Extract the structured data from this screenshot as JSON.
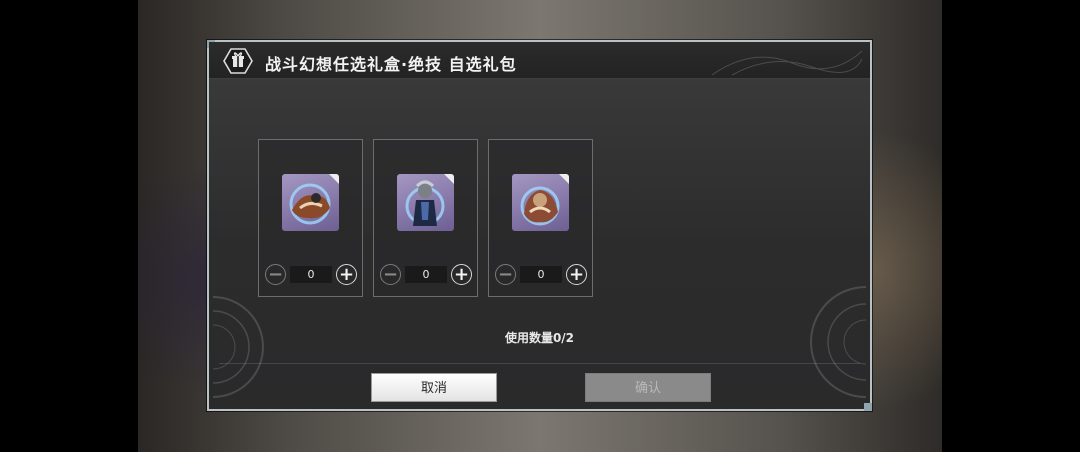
{
  "dialog": {
    "title": "战斗幻想任选礼盒·绝技 自选礼包",
    "header_icon": "gift-box-icon"
  },
  "items": [
    {
      "name": "skill-item-1",
      "icon": "character-portrait-icon",
      "quantity": "0"
    },
    {
      "name": "skill-item-2",
      "icon": "character-portrait-icon",
      "quantity": "0"
    },
    {
      "name": "skill-item-3",
      "icon": "character-portrait-icon",
      "quantity": "0"
    }
  ],
  "usage_text": "使用数量0/2",
  "buttons": {
    "cancel": "取消",
    "confirm": "确认"
  },
  "stepper": {
    "minus": "−",
    "plus": "+"
  }
}
